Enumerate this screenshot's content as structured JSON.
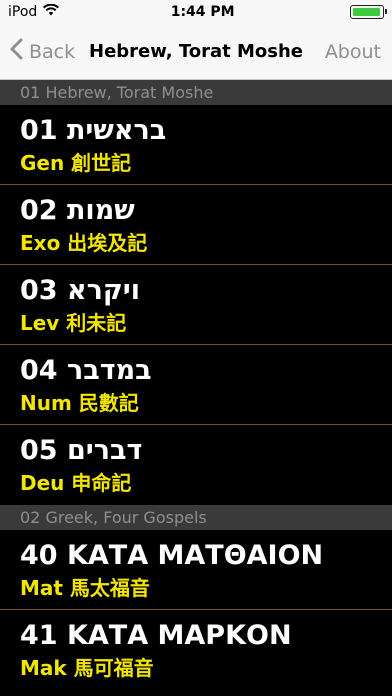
{
  "status_bar": {
    "carrier": "iPod",
    "time": "1:44 PM",
    "battery_level": 0.95
  },
  "nav": {
    "back_label": "Back",
    "title": "Hebrew, Torat Moshe",
    "about_label": "About"
  },
  "sections": [
    {
      "header": "01 Hebrew, Torat Moshe",
      "rows": [
        {
          "num": "01",
          "title": "בראשית",
          "sub": "Gen 創世記"
        },
        {
          "num": "02",
          "title": "שמות",
          "sub": "Exo 出埃及記"
        },
        {
          "num": "03",
          "title": "ויקרא",
          "sub": "Lev 利未記"
        },
        {
          "num": "04",
          "title": "במדבר",
          "sub": "Num 民數記"
        },
        {
          "num": "05",
          "title": "דברים",
          "sub": "Deu 申命記"
        }
      ]
    },
    {
      "header": "02 Greek, Four Gospels",
      "rows": [
        {
          "num": "40",
          "title": "ΚΑΤΑ ΜΑΤΘΑΙΟΝ",
          "sub": "Mat 馬太福音"
        },
        {
          "num": "41",
          "title": "ΚΑΤΑ ΜΑΡΚΟΝ",
          "sub": "Mak 馬可福音"
        }
      ]
    }
  ],
  "icons": {
    "wifi": "wifi-icon",
    "back": "chevron-left-icon",
    "battery": "battery-icon"
  },
  "colors": {
    "subtitle": "#f2e600",
    "divider": "#7a4f2a",
    "section_header_bg": "#3a3a3a",
    "battery": "#3ecc3e"
  }
}
